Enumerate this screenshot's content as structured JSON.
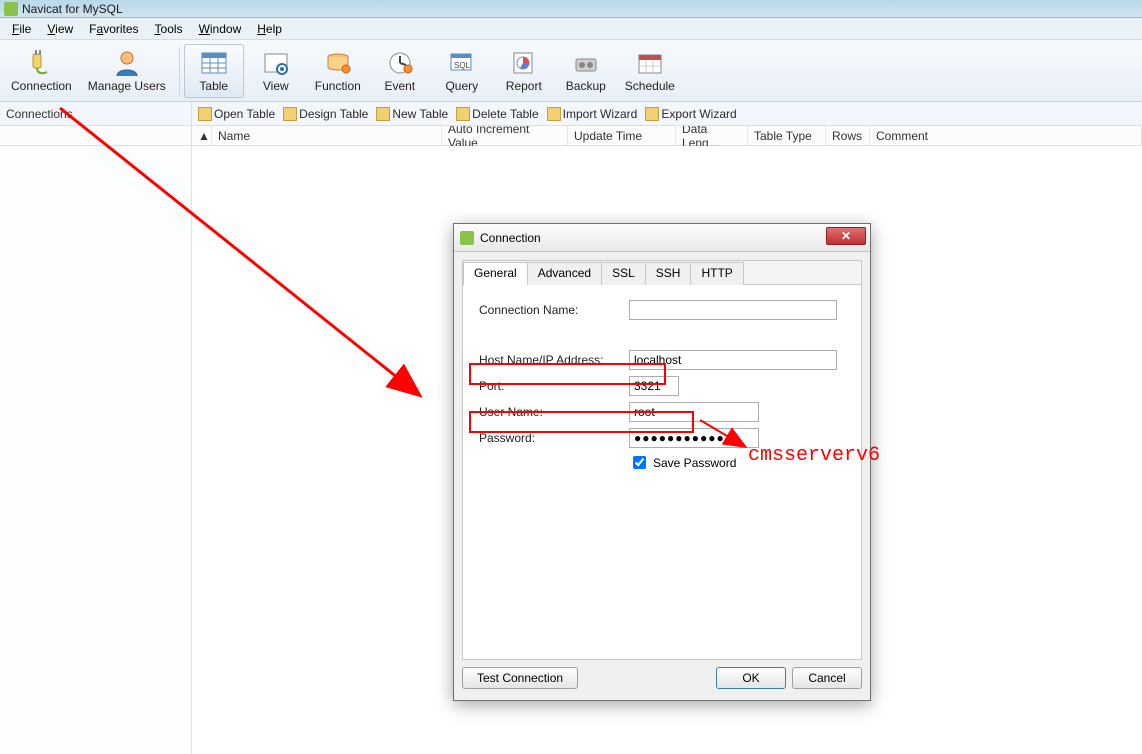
{
  "app": {
    "title": "Navicat for MySQL"
  },
  "menu": {
    "file": "File",
    "view": "View",
    "favorites": "Favorites",
    "tools": "Tools",
    "window": "Window",
    "help": "Help"
  },
  "toolbar": {
    "connection": "Connection",
    "manage_users": "Manage Users",
    "table": "Table",
    "view": "View",
    "function": "Function",
    "event": "Event",
    "query": "Query",
    "report": "Report",
    "backup": "Backup",
    "schedule": "Schedule"
  },
  "sidebar_header": "Connections",
  "sub_actions": {
    "open_table": "Open Table",
    "design_table": "Design Table",
    "new_table": "New Table",
    "delete_table": "Delete Table",
    "import_wizard": "Import Wizard",
    "export_wizard": "Export Wizard"
  },
  "columns": {
    "name": "Name",
    "auto_inc": "Auto Increment Value",
    "update_time": "Update Time",
    "data_length": "Data Leng...",
    "table_type": "Table Type",
    "rows": "Rows",
    "comment": "Comment"
  },
  "dialog": {
    "title": "Connection",
    "tabs": {
      "general": "General",
      "advanced": "Advanced",
      "ssl": "SSL",
      "ssh": "SSH",
      "http": "HTTP"
    },
    "fields": {
      "conn_name_label": "Connection Name:",
      "conn_name_value": "",
      "host_label": "Host Name/IP Address:",
      "host_value": "localhost",
      "port_label": "Port:",
      "port_value": "3321",
      "user_label": "User Name:",
      "user_value": "root",
      "password_label": "Password:",
      "password_value": "●●●●●●●●●●●",
      "save_pwd_label": "Save Password"
    },
    "buttons": {
      "test": "Test Connection",
      "ok": "OK",
      "cancel": "Cancel"
    }
  },
  "annotation": "cmsserverv6"
}
